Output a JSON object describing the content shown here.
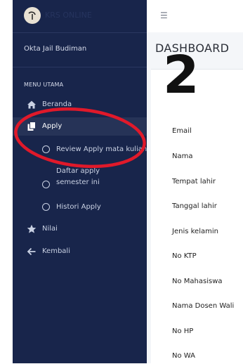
{
  "sidebar": {
    "brand_text": "KRS ONLINE",
    "user_name": "Okta Jail Budiman",
    "menu_header": "MENU UTAMA",
    "items": {
      "beranda": "Beranda",
      "apply": "Apply",
      "review_apply": "Review Apply mata kuliah",
      "daftar_apply_line1": "Daftar apply",
      "daftar_apply_line2": "semester ini",
      "histori_apply": "Histori Apply",
      "nilai": "Nilai",
      "kembali": "Kembali"
    }
  },
  "header": {
    "menu_icon": "hamburger-icon"
  },
  "main": {
    "title": "DASHBOARD",
    "fields": [
      "Email",
      "Nama",
      "Tempat lahir",
      "Tanggal lahir",
      "Jenis kelamin",
      "No KTP",
      "No Mahasiswa",
      "Nama Dosen Wali",
      "No HP",
      "No WA"
    ]
  },
  "annotation": {
    "label": "2",
    "color": "#e0192a"
  }
}
